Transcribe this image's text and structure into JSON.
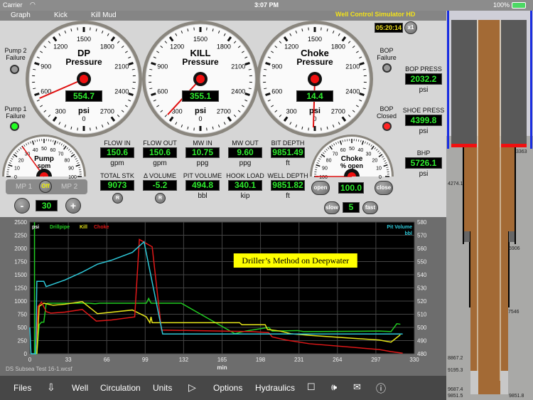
{
  "status": {
    "carrier": "Carrier",
    "time": "3:07 PM",
    "battery": "100%"
  },
  "menu": {
    "items": [
      "Graph",
      "Kick",
      "Kill Mud"
    ],
    "app_title": "Well Control Simulator HD"
  },
  "clock": {
    "time": "05:20:14",
    "speed": "x1"
  },
  "indicators": {
    "pump2": "Pump 2 Failure",
    "pump1": "Pump 1 Failure",
    "bop_failure": "BOP Failure",
    "bop_closed": "BOP Closed"
  },
  "gauges": [
    {
      "title1": "DP",
      "title2": "Pressure",
      "display": "554.7",
      "value": 554.7,
      "unit": "psi"
    },
    {
      "title1": "KILL",
      "title2": "Pressure",
      "display": "355.1",
      "value": 355.1,
      "unit": "psi"
    },
    {
      "title1": "Choke",
      "title2": "Pressure",
      "display": "14.4",
      "value": 14.4,
      "unit": "psi"
    }
  ],
  "gauge_labels": [
    "0",
    "300",
    "600",
    "900",
    "1200",
    "1500",
    "1800",
    "2100",
    "2400",
    "2700"
  ],
  "readouts": [
    {
      "label": "FLOW IN",
      "value": "150.6",
      "unit": "gpm"
    },
    {
      "label": "FLOW OUT",
      "value": "150.6",
      "unit": "gpm"
    },
    {
      "label": "MW IN",
      "value": "10.75",
      "unit": "ppg"
    },
    {
      "label": "MW OUT",
      "value": "9.60",
      "unit": "ppg"
    },
    {
      "label": "BIT DEPTH",
      "value": "9851.49",
      "unit": "ft"
    },
    {
      "label": "TOTAL STK",
      "value": "9073",
      "reset": "R"
    },
    {
      "label": "Δ VOLUME",
      "value": "-5.2",
      "reset": "R"
    },
    {
      "label": "PIT VOLUME",
      "value": "494.8",
      "unit": "bbl"
    },
    {
      "label": "HOOK LOAD",
      "value": "340.1",
      "unit": "kip"
    },
    {
      "label": "WELL DEPTH",
      "value": "9851.82",
      "unit": "ft"
    }
  ],
  "pump": {
    "title": "Pump",
    "unit": "spm",
    "value": 30,
    "labels": [
      "0",
      "10",
      "20",
      "30",
      "40",
      "50",
      "60",
      "70",
      "80",
      "90",
      "100"
    ],
    "mp1": "MP 1",
    "off": "Off",
    "mp2": "MP 2",
    "display": "30",
    "minus": "-",
    "plus": "+"
  },
  "choke": {
    "title": "Choke",
    "unit": "% open",
    "value": 100,
    "labels": [
      "100",
      "90",
      "80",
      "70",
      "60",
      "50",
      "40",
      "30",
      "20",
      "10",
      "0"
    ],
    "display": "100.0",
    "open": "open",
    "close": "close",
    "slow": "slow",
    "fast": "fast",
    "rate": "5"
  },
  "right_readouts": [
    {
      "label": "BOP PRESS",
      "value": "2032.2",
      "unit": "psi"
    },
    {
      "label": "SHOE PRESS",
      "value": "4399.8",
      "unit": "psi"
    },
    {
      "label": "BHP",
      "value": "5726.1",
      "unit": "psi"
    }
  ],
  "chart_data": {
    "type": "line",
    "xlabel": "min",
    "ylabel": "psi",
    "y2label": "bbl",
    "xlim": [
      0,
      330
    ],
    "ylim": [
      0,
      2500
    ],
    "y2lim": [
      480,
      580
    ],
    "xticks": [
      0,
      33,
      66,
      99,
      132,
      165,
      198,
      231,
      264,
      297,
      330
    ],
    "yticks": [
      0,
      250,
      500,
      750,
      1000,
      1250,
      1500,
      1750,
      2000,
      2250,
      2500
    ],
    "y2ticks": [
      480,
      490,
      500,
      510,
      520,
      530,
      540,
      550,
      560,
      570,
      580
    ],
    "annotation": {
      "text": "Driller’s Method on Deepwater",
      "x": 228,
      "y": 1770
    },
    "footer": "DS Subsea Test 16-1.wcsf",
    "series": [
      {
        "name": "Drillpipe",
        "color": "#22cc22",
        "axis": "left",
        "points": [
          [
            4,
            0
          ],
          [
            4,
            2500
          ],
          [
            4,
            0
          ],
          [
            6,
            0
          ],
          [
            8,
            550
          ],
          [
            10,
            600
          ],
          [
            12,
            600
          ],
          [
            14,
            950
          ],
          [
            15,
            960
          ],
          [
            50,
            960
          ],
          [
            56,
            950
          ],
          [
            60,
            960
          ],
          [
            100,
            960
          ],
          [
            102,
            1050
          ],
          [
            104,
            960
          ],
          [
            130,
            960
          ],
          [
            176,
            380
          ],
          [
            185,
            430
          ],
          [
            205,
            500
          ],
          [
            208,
            430
          ],
          [
            230,
            440
          ],
          [
            235,
            420
          ],
          [
            300,
            430
          ],
          [
            310,
            420
          ],
          [
            315,
            570
          ],
          [
            318,
            560
          ]
        ]
      },
      {
        "name": "Kill",
        "color": "#e6e61a",
        "axis": "left",
        "points": [
          [
            6,
            0
          ],
          [
            8,
            900
          ],
          [
            12,
            960
          ],
          [
            20,
            920
          ],
          [
            30,
            940
          ],
          [
            45,
            990
          ],
          [
            58,
            760
          ],
          [
            88,
            830
          ],
          [
            100,
            700
          ],
          [
            103,
            590
          ],
          [
            104,
            700
          ],
          [
            105,
            590
          ],
          [
            180,
            590
          ],
          [
            182,
            550
          ],
          [
            202,
            550
          ],
          [
            204,
            460
          ],
          [
            215,
            430
          ],
          [
            224,
            380
          ],
          [
            240,
            350
          ],
          [
            300,
            260
          ],
          [
            310,
            220
          ],
          [
            318,
            360
          ]
        ]
      },
      {
        "name": "Choke",
        "color": "#e01818",
        "axis": "left",
        "points": [
          [
            5,
            0
          ],
          [
            7,
            900
          ],
          [
            10,
            980
          ],
          [
            14,
            800
          ],
          [
            18,
            770
          ],
          [
            30,
            790
          ],
          [
            45,
            840
          ],
          [
            57,
            620
          ],
          [
            70,
            640
          ],
          [
            90,
            700
          ],
          [
            94,
            2170
          ],
          [
            105,
            2030
          ],
          [
            113,
            450
          ],
          [
            190,
            420
          ],
          [
            205,
            400
          ],
          [
            208,
            320
          ],
          [
            220,
            260
          ],
          [
            240,
            190
          ],
          [
            300,
            80
          ],
          [
            310,
            40
          ],
          [
            320,
            10
          ]
        ]
      },
      {
        "name": "Pit Volume",
        "color": "#2ec8d8",
        "axis": "right",
        "points": [
          [
            0,
            500
          ],
          [
            1,
            480
          ],
          [
            5,
            480
          ],
          [
            6,
            535
          ],
          [
            12,
            535
          ],
          [
            14,
            531
          ],
          [
            30,
            536
          ],
          [
            45,
            542
          ],
          [
            58,
            548
          ],
          [
            70,
            551
          ],
          [
            88,
            557
          ],
          [
            98,
            565
          ],
          [
            114,
            495
          ],
          [
            320,
            495
          ]
        ]
      }
    ]
  },
  "well": {
    "depths": {
      "d3363": "3363",
      "d4274": "4274.1",
      "d5906": "5906",
      "d7546": "7546",
      "d8867": "8867.2",
      "d9195": "9195.3",
      "d9687": "9687.4",
      "d9851l": "9851.5",
      "d9851r": "9851.8"
    }
  },
  "toolbar": {
    "files": "Files",
    "well": "Well",
    "circulation": "Circulation",
    "units": "Units",
    "options": "Options",
    "hydraulics": "Hydraulics"
  }
}
